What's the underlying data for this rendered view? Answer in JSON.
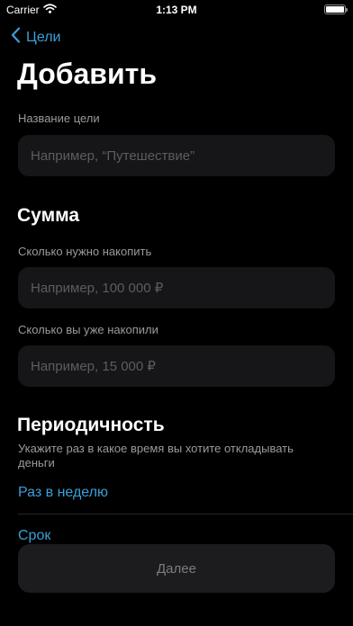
{
  "status_bar": {
    "carrier": "Carrier",
    "time": "1:13 PM",
    "battery_level": 1.0
  },
  "nav": {
    "back_label": "Цели"
  },
  "page": {
    "title": "Добавить"
  },
  "goal_name": {
    "label": "Название цели",
    "placeholder": "Например, “Путешествие”",
    "value": ""
  },
  "amount": {
    "title": "Сумма",
    "target_label": "Сколько нужно накопить",
    "target_placeholder": "Например, 100 000 ₽",
    "target_value": "",
    "saved_label": "Сколько вы уже накопили",
    "saved_placeholder": "Например, 15 000 ₽",
    "saved_value": ""
  },
  "periodicity": {
    "title": "Периодичность",
    "hint": "Укажите раз в какое время вы хотите откладывать деньги",
    "selected_option": "Раз в неделю"
  },
  "deadline": {
    "label": "Срок"
  },
  "actions": {
    "next_label": "Далее"
  },
  "colors": {
    "accent": "#3a9fd8",
    "background": "#000000",
    "field_background": "#161618",
    "button_background": "#1c1c1e",
    "secondary_text": "#9a9a9f"
  }
}
